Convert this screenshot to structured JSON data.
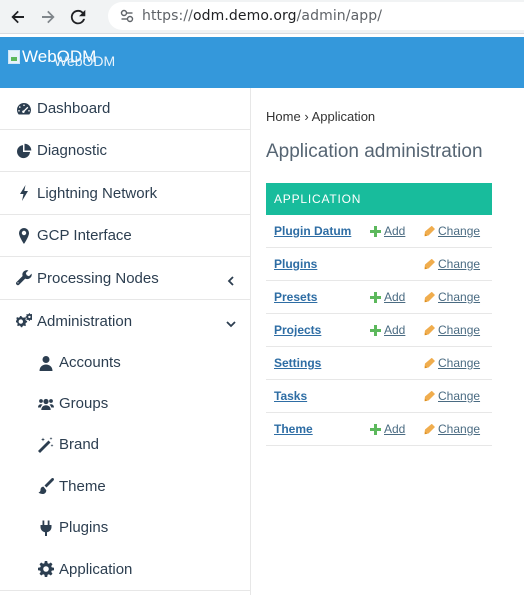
{
  "browser": {
    "url_scheme": "https://",
    "url_host": "odm.demo.org",
    "url_path": "/admin/app/"
  },
  "header": {
    "brand_alt": "WebODM",
    "brand_text": "WebODM",
    "color": "#3498db"
  },
  "sidebar": {
    "items": [
      {
        "label": "Dashboard",
        "icon": "dashboard-icon"
      },
      {
        "label": "Diagnostic",
        "icon": "pie-chart-icon"
      },
      {
        "label": "Lightning Network",
        "icon": "bolt-icon"
      },
      {
        "label": "GCP Interface",
        "icon": "map-marker-icon"
      },
      {
        "label": "Processing Nodes",
        "icon": "wrench-icon",
        "arrow": "chevron-left-icon"
      },
      {
        "label": "Administration",
        "icon": "cogs-icon",
        "arrow": "chevron-down-icon"
      }
    ],
    "subitems": [
      {
        "label": "Accounts",
        "icon": "user-icon"
      },
      {
        "label": "Groups",
        "icon": "users-icon"
      },
      {
        "label": "Brand",
        "icon": "magic-icon"
      },
      {
        "label": "Theme",
        "icon": "paint-brush-icon"
      },
      {
        "label": "Plugins",
        "icon": "plug-icon"
      },
      {
        "label": "Application",
        "icon": "cog-icon"
      }
    ]
  },
  "main": {
    "breadcrumb_home": "Home",
    "breadcrumb_sep": "›",
    "breadcrumb_current": "Application",
    "title": "Application administration",
    "module_caption": "APPLICATION",
    "add_label": "Add",
    "change_label": "Change",
    "models": [
      {
        "name": "Plugin Datum",
        "add": true
      },
      {
        "name": "Plugins",
        "add": false
      },
      {
        "name": "Presets",
        "add": true
      },
      {
        "name": "Projects",
        "add": true
      },
      {
        "name": "Settings",
        "add": false
      },
      {
        "name": "Tasks",
        "add": false
      },
      {
        "name": "Theme",
        "add": true
      }
    ],
    "colors": {
      "caption": "#18bc9c",
      "add_icon": "#5cb85c",
      "change_icon": "#f0ad4e"
    }
  }
}
